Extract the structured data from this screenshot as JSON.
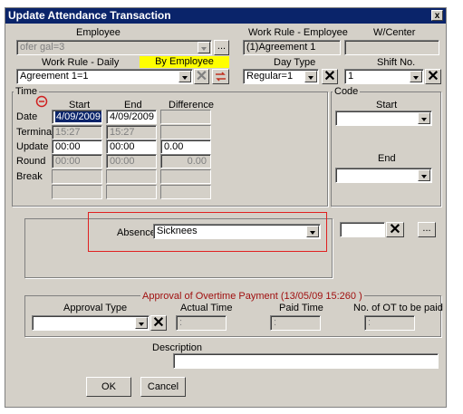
{
  "window": {
    "title": "Update Attendance Transaction",
    "close_label": "x"
  },
  "header": {
    "employee_label": "Employee",
    "employee_value": "ofer gal=3",
    "ellipsis": "...",
    "work_rule_employee_label": "Work Rule - Employee",
    "work_rule_employee_value": "(1)Agreement 1",
    "wcenter_label": "W/Center",
    "wcenter_value": "",
    "work_rule_daily_label": "Work Rule - Daily",
    "by_employee_label": "By Employee",
    "work_rule_daily_value": "Agreement 1=1",
    "day_type_label": "Day Type",
    "day_type_value": "Regular=1",
    "shift_no_label": "Shift No.",
    "shift_no_value": "1"
  },
  "time_group": {
    "label": "Time",
    "col_start": "Start",
    "col_end": "End",
    "col_difference": "Difference",
    "rows": {
      "date_label": "Date",
      "date_start": "4/09/2009",
      "date_end": "4/09/2009",
      "terminal_label": "Terminal",
      "terminal_start": "15:27",
      "terminal_end": "15:27",
      "update_label": "Update",
      "update_start": "00:00",
      "update_end": "00:00",
      "update_diff": "0.00",
      "round_label": "Round",
      "round_start": "00:00",
      "round_end": "00:00",
      "round_diff": "0.00",
      "break_label": "Break"
    }
  },
  "code_group": {
    "label": "Code",
    "start_label": "Start",
    "end_label": "End"
  },
  "absence": {
    "label": "Absence",
    "value": "Sicknees",
    "ellipsis": "..."
  },
  "overtime": {
    "title": "Approval of Overtime Payment (13/05/09 15:260 )",
    "approval_type_label": "Approval Type",
    "actual_time_label": "Actual Time",
    "actual_time_value": ":",
    "paid_time_label": "Paid Time",
    "paid_time_value": ":",
    "ot_count_label": "No. of OT to be paid",
    "ot_count_value": ":"
  },
  "description": {
    "label": "Description",
    "value": ""
  },
  "buttons": {
    "ok": "OK",
    "cancel": "Cancel"
  },
  "colors": {
    "title_bar": "#0a246a",
    "dialog_bg": "#d4d0c8",
    "highlight": "#ffff00",
    "absence_outline": "#e02020"
  }
}
